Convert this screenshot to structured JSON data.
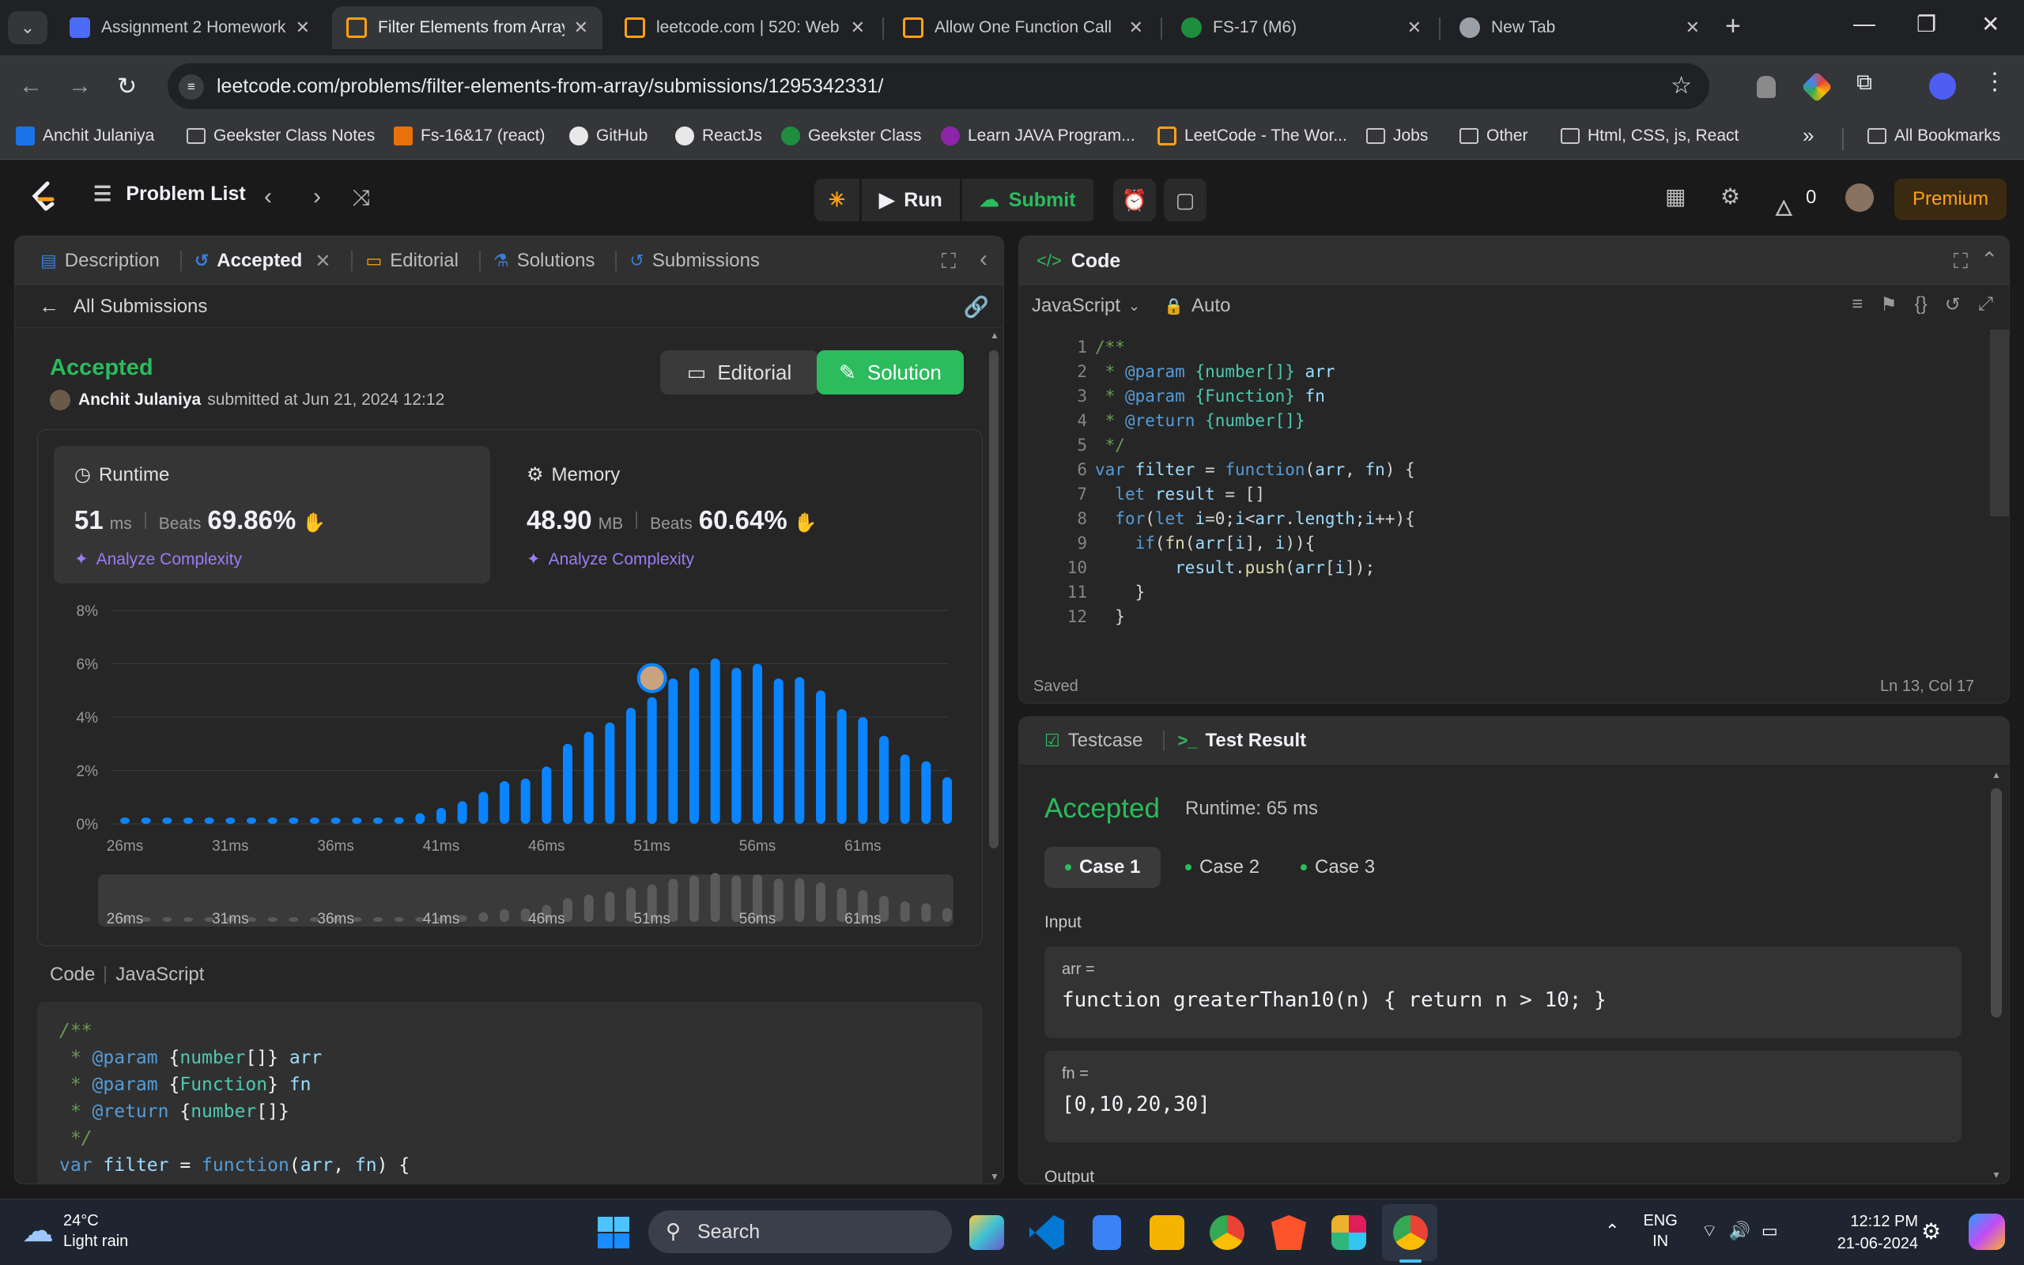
{
  "browser": {
    "tabs": [
      {
        "title": "Assignment 2 Homework",
        "favicon_color": "#4a6cf7"
      },
      {
        "title": "Filter Elements from Array",
        "favicon_color": "#ffa116"
      },
      {
        "title": "leetcode.com | 520: Web",
        "favicon_color": "#ffa116"
      },
      {
        "title": "Allow One Function Call",
        "favicon_color": "#ffa116"
      },
      {
        "title": "FS-17 (M6)",
        "favicon_color": "#1e8e3e"
      },
      {
        "title": "New Tab",
        "favicon_color": "#9aa0a6"
      }
    ],
    "url": "leetcode.com/problems/filter-elements-from-array/submissions/1295342331/",
    "bookmarks": [
      {
        "label": "Anchit Julaniya",
        "icon": "person-icon"
      },
      {
        "label": "Geekster Class Notes",
        "icon": "folder-icon"
      },
      {
        "label": "Fs-16&17 (react)",
        "icon": "doc-icon"
      },
      {
        "label": "GitHub",
        "icon": "github-icon"
      },
      {
        "label": "ReactJs",
        "icon": "github-icon"
      },
      {
        "label": "Geekster Class",
        "icon": "geekster-icon"
      },
      {
        "label": "Learn JAVA Program...",
        "icon": "learn-icon"
      },
      {
        "label": "LeetCode - The Wor...",
        "icon": "leetcode-icon"
      },
      {
        "label": "Jobs",
        "icon": "folder-icon"
      },
      {
        "label": "Other",
        "icon": "folder-icon"
      },
      {
        "label": "Html, CSS, js, React",
        "icon": "folder-icon"
      }
    ],
    "more_bookmarks": "»",
    "all_bookmarks": "All Bookmarks"
  },
  "lc_header": {
    "problem_list": "Problem List",
    "run": "Run",
    "submit": "Submit",
    "streak": "0",
    "premium": "Premium"
  },
  "left_panel": {
    "tabs": [
      "Description",
      "Accepted",
      "Editorial",
      "Solutions",
      "Submissions"
    ],
    "all_submissions": "All Submissions",
    "status": "Accepted",
    "submitter": "Anchit Julaniya",
    "submitted_at": "submitted at Jun 21, 2024 12:12",
    "editorial_btn": "Editorial",
    "solution_btn": "Solution",
    "runtime": {
      "label": "Runtime",
      "value": "51",
      "unit": "ms",
      "beats_label": "Beats",
      "beats": "69.86%",
      "analyze": "Analyze Complexity"
    },
    "memory": {
      "label": "Memory",
      "value": "48.90",
      "unit": "MB",
      "beats_label": "Beats",
      "beats": "60.64%",
      "analyze": "Analyze Complexity"
    },
    "code_label": "Code",
    "code_lang": "JavaScript",
    "code_lines": [
      "/**",
      " * @param {number[]} arr",
      " * @param {Function} fn",
      " * @return {number[]}",
      " */",
      "var filter = function(arr, fn) {"
    ]
  },
  "chart_data": {
    "type": "bar",
    "xlabel": "",
    "ylabel": "",
    "y_ticks": [
      "0%",
      "2%",
      "4%",
      "6%",
      "8%"
    ],
    "ylim": [
      0,
      8
    ],
    "x_tick_labels": [
      "26ms",
      "31ms",
      "36ms",
      "41ms",
      "46ms",
      "51ms",
      "56ms",
      "61ms"
    ],
    "bars": [
      {
        "ms": 26,
        "pct": 0.1
      },
      {
        "ms": 27,
        "pct": 0.1
      },
      {
        "ms": 28,
        "pct": 0.1
      },
      {
        "ms": 29,
        "pct": 0.1
      },
      {
        "ms": 30,
        "pct": 0.1
      },
      {
        "ms": 31,
        "pct": 0.1
      },
      {
        "ms": 32,
        "pct": 0.1
      },
      {
        "ms": 33,
        "pct": 0.1
      },
      {
        "ms": 34,
        "pct": 0.1
      },
      {
        "ms": 35,
        "pct": 0.1
      },
      {
        "ms": 36,
        "pct": 0.1
      },
      {
        "ms": 37,
        "pct": 0.1
      },
      {
        "ms": 38,
        "pct": 0.15
      },
      {
        "ms": 39,
        "pct": 0.25
      },
      {
        "ms": 40,
        "pct": 0.4
      },
      {
        "ms": 41,
        "pct": 0.6
      },
      {
        "ms": 42,
        "pct": 0.85
      },
      {
        "ms": 43,
        "pct": 1.2
      },
      {
        "ms": 44,
        "pct": 1.6
      },
      {
        "ms": 45,
        "pct": 1.7
      },
      {
        "ms": 46,
        "pct": 2.15
      },
      {
        "ms": 47,
        "pct": 3.0
      },
      {
        "ms": 48,
        "pct": 3.45
      },
      {
        "ms": 49,
        "pct": 3.8
      },
      {
        "ms": 50,
        "pct": 4.35
      },
      {
        "ms": 51,
        "pct": 4.75
      },
      {
        "ms": 52,
        "pct": 5.45
      },
      {
        "ms": 53,
        "pct": 5.85
      },
      {
        "ms": 54,
        "pct": 6.2
      },
      {
        "ms": 55,
        "pct": 5.85
      },
      {
        "ms": 56,
        "pct": 6.0
      },
      {
        "ms": 57,
        "pct": 5.45
      },
      {
        "ms": 58,
        "pct": 5.5
      },
      {
        "ms": 59,
        "pct": 5.0
      },
      {
        "ms": 60,
        "pct": 4.3
      },
      {
        "ms": 61,
        "pct": 4.0
      },
      {
        "ms": 62,
        "pct": 3.3
      },
      {
        "ms": 63,
        "pct": 2.6
      },
      {
        "ms": 64,
        "pct": 2.35
      },
      {
        "ms": 65,
        "pct": 1.75
      }
    ],
    "highlight_ms": 51,
    "grid": true
  },
  "code_panel": {
    "title": "Code",
    "language": "JavaScript",
    "mode": "Auto",
    "status": "Saved",
    "cursor": "Ln 13, Col 17"
  },
  "test_panel": {
    "tab_testcase": "Testcase",
    "tab_result": "Test Result",
    "status": "Accepted",
    "runtime": "Runtime: 65 ms",
    "cases": [
      "Case 1",
      "Case 2",
      "Case 3"
    ],
    "input_label": "Input",
    "arr_label": "arr =",
    "arr_value": "function greaterThan10(n) { return n > 10; }",
    "fn_label": "fn =",
    "fn_value": "[0,10,20,30]",
    "output_label": "Output"
  },
  "taskbar": {
    "temperature": "24°C",
    "weather": "Light rain",
    "search": "Search",
    "lang1": "ENG",
    "lang2": "IN",
    "time": "12:12 PM",
    "date": "21-06-2024"
  },
  "colors": {
    "accent_green": "#2cbb5d",
    "bar_blue": "#0a84ff",
    "premium": "#ffa116"
  }
}
